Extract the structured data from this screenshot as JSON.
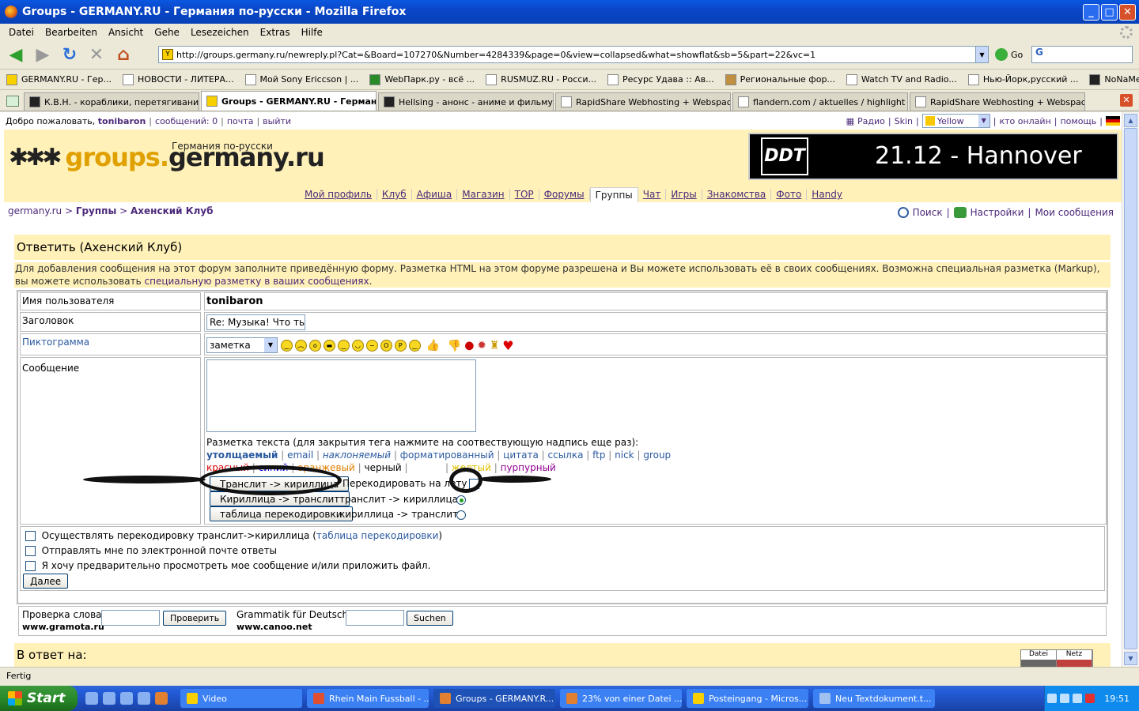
{
  "window": {
    "title": "Groups - GERMANY.RU - Германия по-русски - Mozilla Firefox",
    "minimize": "_",
    "maximize": "□",
    "close": "✕"
  },
  "menu": [
    "Datei",
    "Bearbeiten",
    "Ansicht",
    "Gehe",
    "Lesezeichen",
    "Extras",
    "Hilfe"
  ],
  "nav": {
    "url": "http://groups.germany.ru/newreply.pl?Cat=&Board=107270&Number=4284339&page=0&view=collapsed&what=showflat&sb=5&part=22&vc=1",
    "go_label": "Go",
    "search_value": "G"
  },
  "bookmarks": [
    "GERMANY.RU - Гер...",
    "НОВОСТИ - ЛИТЕРА...",
    "Мой Sony Ericcson | ...",
    "WebПарк.ру - всё ...",
    "RUSMUZ.RU - Росси...",
    "Ресурс Удава :: Ав...",
    "Региональные фор...",
    "Watch TV and Radio...",
    "Нью-Йорк,русский ...",
    "NoNaMe - скачать ..."
  ],
  "tabs": [
    "К.В.Н. - кораблики, перетягивание кан...",
    "Groups - GERMANY.RU - Германи...",
    "Hellsing - анонс - аниме и фильму",
    "RapidShare Webhosting + Webspace",
    "flandern.com / aktuelles / highlight",
    "RapidShare Webhosting + Webspace"
  ],
  "userbar": {
    "welcome": "Добро пожаловать,",
    "username": "tonibaron",
    "messages": "сообщений: 0",
    "mail": "почта",
    "logout": "выйти",
    "radio": "Радио",
    "skin": "Skin",
    "skin_value": "Yellow",
    "online": "кто онлайн",
    "help": "помощь"
  },
  "header": {
    "logo_part1": "groups.",
    "logo_part2": "germany.ru",
    "tagline": "Германия по-русски",
    "banner_logo": "DDT",
    "banner_text": "21.12 - Hannover"
  },
  "mainnav": [
    "Мой профиль",
    "Клуб",
    "Афиша",
    "Магазин",
    "TOP",
    "Форумы",
    "Группы",
    "Чат",
    "Игры",
    "Знакомства",
    "Фото",
    "Handy"
  ],
  "crumbs": {
    "home": "germany.ru",
    "sep1": " > ",
    "groups": "Группы",
    "sep2": " > ",
    "club": "Ахенский Клуб"
  },
  "toplinks": {
    "search": "Поиск",
    "settings": "Настройки",
    "my_messages": "Мои сообщения"
  },
  "reply": {
    "title": "Ответить (Ахенский Клуб)",
    "intro_text": "Для добавления сообщения на этот форум заполните приведённую форму. Разметка HTML на этом форуме разрешена и Вы можете использовать её в своих сообщениях. Возможна специальная разметка (Markup), вы можете использовать",
    "intro_link": "специальную разметку в ваших сообщениях",
    "intro_end": ".",
    "username_label": "Имя пользователя",
    "username_value": "tonibaron",
    "subject_label": "Заголовок",
    "subject_value": "Re: Музыка! Что ты с",
    "icon_label": "Пиктограмма",
    "icon_select": "заметка",
    "message_label": "Сообщение",
    "markup_title": "Разметка текста (для закрытия тега нажмите на соотвествующую надпись еще раз):",
    "markup_links": [
      "утолщаемый",
      "email",
      "наклоняемый",
      "форматированный",
      "цитата",
      "ссылка",
      "ftp",
      "nick",
      "group"
    ],
    "colors": [
      "красный",
      "синий",
      "оранжевый",
      "черный",
      "белый",
      "желтый",
      "пурпурный"
    ],
    "translit_btn": "Транслит -> кириллица",
    "cyr_btn": "Кириллица -> транслит",
    "table_btn": "таблица перекодировки",
    "recode_label": "Перекодировать на лету",
    "radio1": "транслит -> кириллица",
    "radio2": "кириллица -> транслит",
    "opt1": "Осуществлять перекодировку транслит->кириллица (",
    "opt1_link": "таблица перекодировки",
    "opt1_end": ")",
    "opt2": "Отправлять мне по электронной почте ответы",
    "opt3": "Я хочу предварительно просмотреть мое сообщение и/или приложить файл.",
    "next_btn": "Далее",
    "spell_label": "Проверка слова",
    "spell_site": "www.gramota.ru",
    "spell_btn": "Проверить",
    "grammar_label": "Grammatik für Deutsch",
    "grammar_site": "www.canoo.net",
    "grammar_btn": "Suchen"
  },
  "answer_title": "В ответ на:",
  "netmon": {
    "datei": "Datei",
    "netz": "Netz"
  },
  "status": "Fertig",
  "taskbar": {
    "start": "Start",
    "tasks": [
      "Video",
      "Rhein Main Fussball - ...",
      "Groups - GERMANY.R...",
      "23% von einer Datei ...",
      "Posteingang - Micros...",
      "Neu Textdokument.t..."
    ],
    "clock": "19:51"
  }
}
